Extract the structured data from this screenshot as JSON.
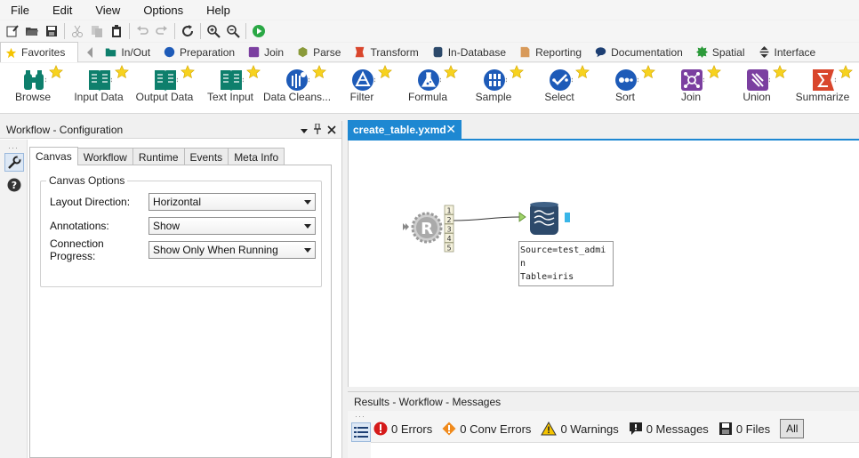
{
  "menu": [
    "File",
    "Edit",
    "View",
    "Options",
    "Help"
  ],
  "category_tabs": [
    {
      "label": "Favorites",
      "icon": "star-icon",
      "color": "#f5c400"
    },
    {
      "label": "In/Out",
      "icon": "folder-icon",
      "color": "#0e7f6c"
    },
    {
      "label": "Preparation",
      "icon": "circle-icon",
      "color": "#1e5bb8"
    },
    {
      "label": "Join",
      "icon": "square-icon",
      "color": "#7b3fa0"
    },
    {
      "label": "Parse",
      "icon": "hexagon-icon",
      "color": "#8a9a3a"
    },
    {
      "label": "Transform",
      "icon": "transform-icon",
      "color": "#d9462c"
    },
    {
      "label": "In-Database",
      "icon": "database-icon",
      "color": "#2d4a6b"
    },
    {
      "label": "Reporting",
      "icon": "report-icon",
      "color": "#d89a5a"
    },
    {
      "label": "Documentation",
      "icon": "speech-icon",
      "color": "#1d3f73"
    },
    {
      "label": "Spatial",
      "icon": "spatial-icon",
      "color": "#2c9a3a"
    },
    {
      "label": "Interface",
      "icon": "interface-icon",
      "color": "#333333"
    }
  ],
  "palette_tools": [
    {
      "label": "Browse",
      "icon": "binoculars-icon",
      "color": "#0e7f6c"
    },
    {
      "label": "Input Data",
      "icon": "book-icon",
      "color": "#0e7f6c"
    },
    {
      "label": "Output Data",
      "icon": "book-icon",
      "color": "#0e7f6c"
    },
    {
      "label": "Text Input",
      "icon": "book-icon",
      "color": "#0e7f6c"
    },
    {
      "label": "Data Cleans...",
      "icon": "cleanse-icon",
      "color": "#1e5bb8"
    },
    {
      "label": "Filter",
      "icon": "filter-icon",
      "color": "#1e5bb8"
    },
    {
      "label": "Formula",
      "icon": "flask-icon",
      "color": "#1e5bb8"
    },
    {
      "label": "Sample",
      "icon": "sample-icon",
      "color": "#1e5bb8"
    },
    {
      "label": "Select",
      "icon": "select-icon",
      "color": "#1e5bb8"
    },
    {
      "label": "Sort",
      "icon": "sort-icon",
      "color": "#1e5bb8"
    },
    {
      "label": "Join",
      "icon": "join-icon",
      "color": "#7b3fa0"
    },
    {
      "label": "Union",
      "icon": "union-icon",
      "color": "#7b3fa0"
    },
    {
      "label": "Summarize",
      "icon": "sigma-icon",
      "color": "#d9462c"
    }
  ],
  "config": {
    "title": "Workflow - Configuration",
    "tabs": [
      "Canvas",
      "Workflow",
      "Runtime",
      "Events",
      "Meta Info"
    ],
    "group_title": "Canvas Options",
    "fields": [
      {
        "label": "Layout Direction:",
        "value": "Horizontal"
      },
      {
        "label": "Annotations:",
        "value": "Show"
      },
      {
        "label": "Connection Progress:",
        "value": "Show Only When Running"
      }
    ]
  },
  "doc_tab": {
    "title": "create_table.yxmd"
  },
  "canvas": {
    "r_outputs": [
      "1",
      "2",
      "3",
      "4",
      "5"
    ],
    "annotation_lines": [
      "Source=test_admi",
      "n",
      "Table=iris"
    ]
  },
  "results": {
    "title": "Results - Workflow - Messages",
    "items": [
      {
        "icon": "error-icon",
        "text": "0 Errors"
      },
      {
        "icon": "conv-error-icon",
        "text": "0 Conv Errors"
      },
      {
        "icon": "warning-icon",
        "text": "0 Warnings"
      },
      {
        "icon": "message-icon",
        "text": "0 Messages"
      },
      {
        "icon": "file-icon",
        "text": "0 Files"
      }
    ],
    "all_label": "All"
  }
}
